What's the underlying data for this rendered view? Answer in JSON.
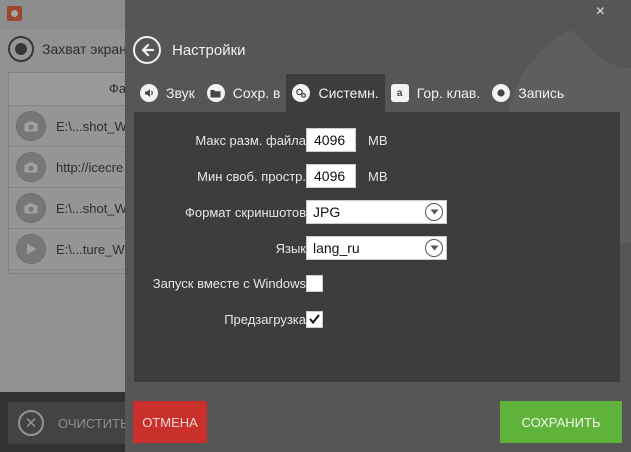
{
  "background_app": {
    "record_label": "Захват экрана",
    "table_header": "Фа",
    "rows": [
      {
        "icon": "camera-icon",
        "text": "E:\\...shot_W"
      },
      {
        "icon": "camera-icon",
        "text": "http://icecre"
      },
      {
        "icon": "camera-icon",
        "text": "E:\\...shot_W"
      },
      {
        "icon": "play-icon",
        "text": "E:\\...ture_W"
      }
    ],
    "clear_label": "ОЧИСТИТЬ"
  },
  "settings": {
    "title": "Настройки",
    "close_glyph": "×",
    "tabs": [
      {
        "label": "Звук",
        "icon": "speaker-icon"
      },
      {
        "label": "Сохр. в",
        "icon": "folder-icon"
      },
      {
        "label": "Системн.",
        "icon": "gears-icon",
        "active": true
      },
      {
        "label": "Гор. клав.",
        "icon": "hotkey-icon"
      },
      {
        "label": "Запись",
        "icon": "record-icon"
      }
    ],
    "fields": {
      "max_file_size": {
        "label": "Макс разм. файла",
        "value": "4096",
        "unit": "MB"
      },
      "min_free_space": {
        "label": "Мин своб. простр.",
        "value": "4096",
        "unit": "MB"
      },
      "screenshot_format": {
        "label": "Формат скриншотов",
        "value": "JPG"
      },
      "language": {
        "label": "Язык",
        "value": "lang_ru"
      },
      "start_with_windows": {
        "label": "Запуск вместе с Windows",
        "checked": false
      },
      "preload": {
        "label": "Предзагрузка",
        "checked": true
      }
    },
    "cancel_label": "ОТМЕНА",
    "save_label": "СОХРАНИТЬ"
  },
  "colors": {
    "panel_bg": "#565656",
    "content_bg": "#3d3d3d",
    "cancel": "#c9302c",
    "save": "#5fb33b"
  }
}
